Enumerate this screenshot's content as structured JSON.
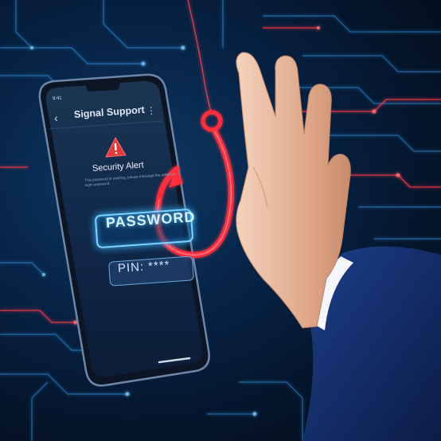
{
  "phone": {
    "status_time": "9:41",
    "app_title": "Signal Support",
    "back_icon": "chevron-left-icon",
    "menu_icon": "more-vertical-icon",
    "alert_icon": "warning-triangle-icon",
    "alert_title": "Security Alert",
    "alert_body": "This password is expiring, please message the admin to login password.",
    "password_label": "PASSWORD",
    "pin_label": "PIN: ****"
  },
  "colors": {
    "background": "#072448",
    "circuit_blue": "#3aa8ff",
    "circuit_red": "#ff3b4a",
    "hook": "#ff2d3d",
    "password_glow": "#57c7ff",
    "suit": "#14306e",
    "skin": "#e6b69a"
  }
}
